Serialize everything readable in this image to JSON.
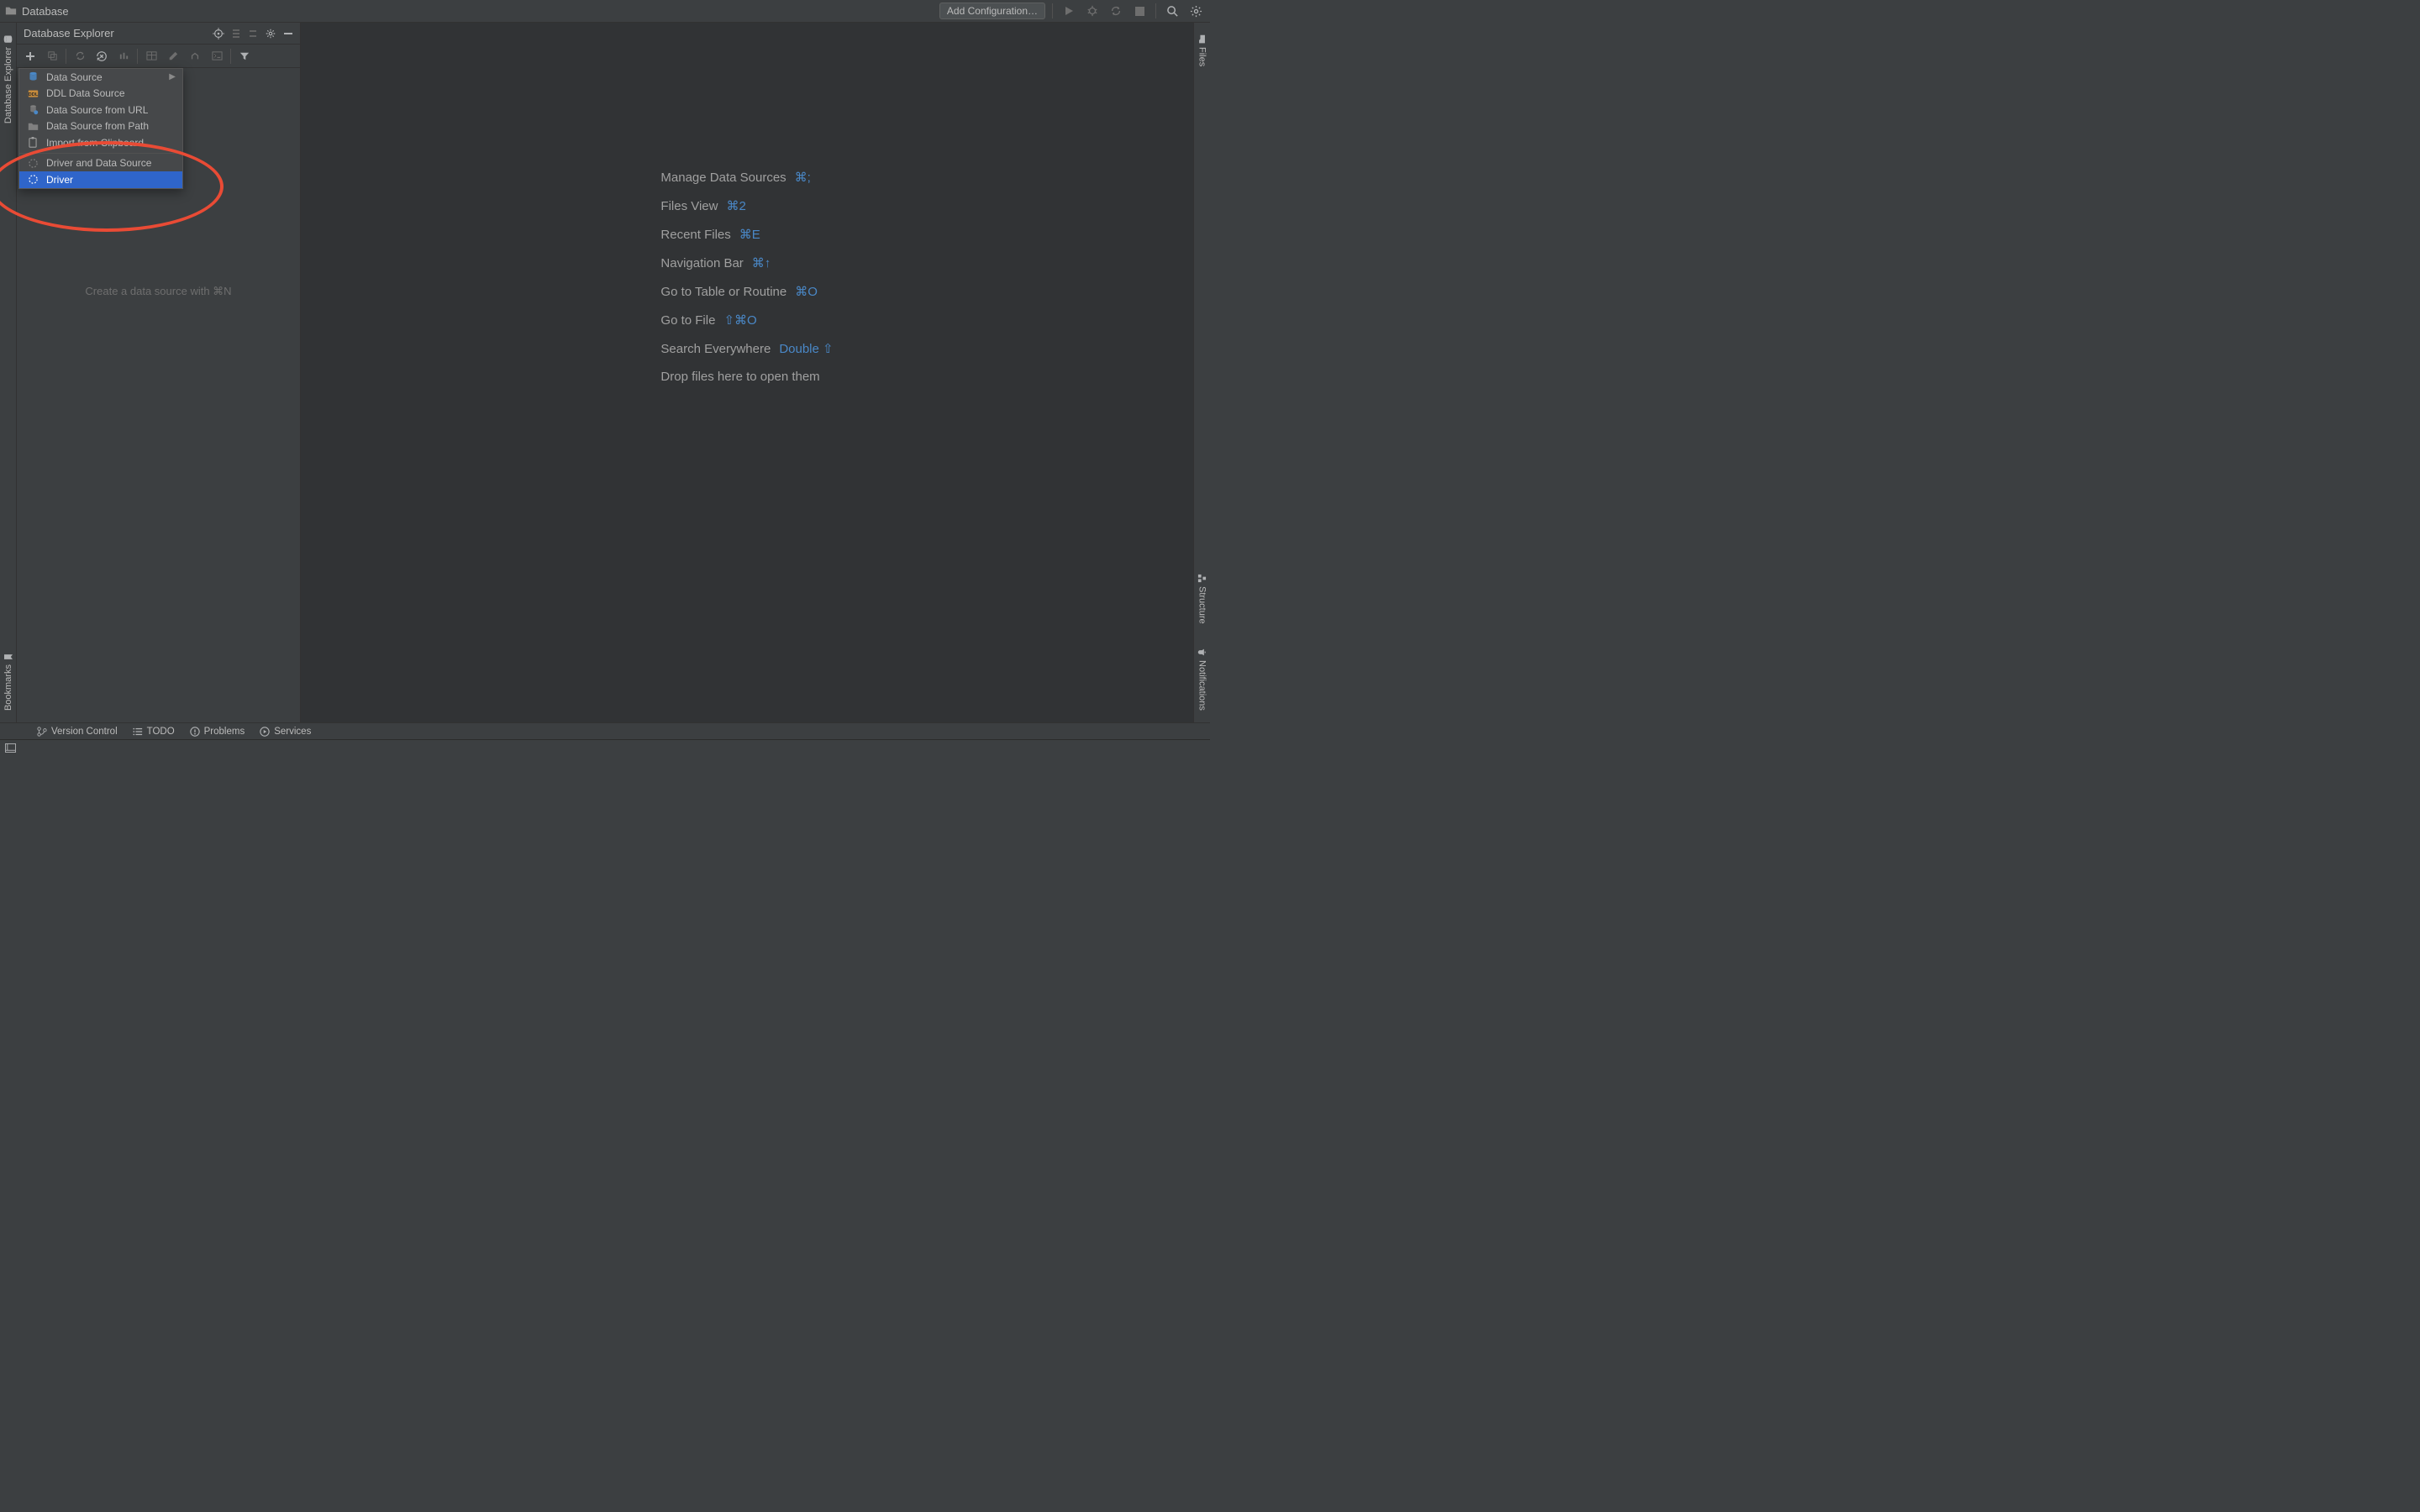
{
  "topbar": {
    "title": "Database",
    "add_config": "Add Configuration…"
  },
  "panel": {
    "title": "Database Explorer",
    "hint": "Create a data source with ⌘N"
  },
  "menu": {
    "items": [
      {
        "label": "Data Source",
        "has_submenu": true
      },
      {
        "label": "DDL Data Source"
      },
      {
        "label": "Data Source from URL"
      },
      {
        "label": "Data Source from Path"
      },
      {
        "label": "Import from Clipboard"
      },
      {
        "label": "Driver and Data Source"
      },
      {
        "label": "Driver",
        "selected": true
      }
    ]
  },
  "shortcuts": [
    {
      "label": "Manage Data Sources",
      "kbd": "⌘;"
    },
    {
      "label": "Files View",
      "kbd": "⌘2"
    },
    {
      "label": "Recent Files",
      "kbd": "⌘E"
    },
    {
      "label": "Navigation Bar",
      "kbd": "⌘↑"
    },
    {
      "label": "Go to Table or Routine",
      "kbd": "⌘O"
    },
    {
      "label": "Go to File",
      "kbd": "⇧⌘O"
    },
    {
      "label": "Search Everywhere",
      "kbd": "Double ⇧"
    },
    {
      "label": "Drop files here to open them",
      "kbd": ""
    }
  ],
  "left_rail": {
    "db_explorer": "Database Explorer",
    "bookmarks": "Bookmarks"
  },
  "right_rail": {
    "files": "Files",
    "structure": "Structure",
    "notifications": "Notifications"
  },
  "bottom": {
    "vcs": "Version Control",
    "todo": "TODO",
    "problems": "Problems",
    "services": "Services"
  }
}
